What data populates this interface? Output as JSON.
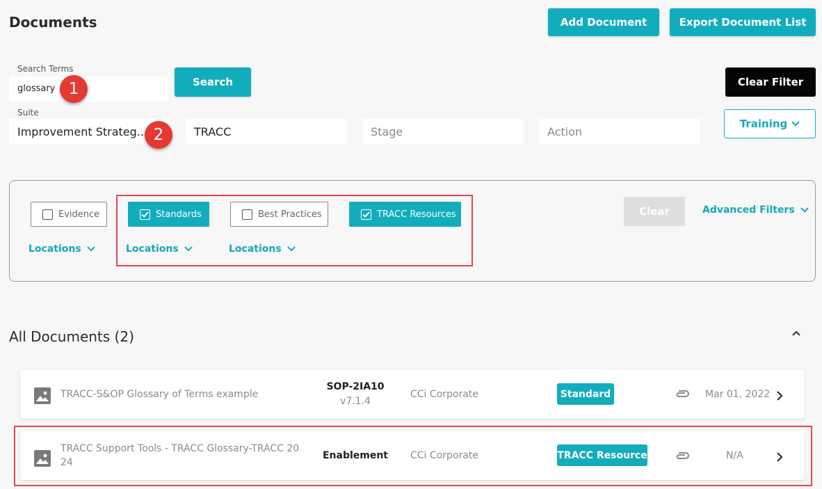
{
  "header": {
    "title": "Documents",
    "add_document": "Add Document",
    "export_list": "Export Document List"
  },
  "search": {
    "label": "Search Terms",
    "value": "glossary",
    "button": "Search",
    "clear_filter": "Clear Filter"
  },
  "suite": {
    "label": "Suite",
    "value": "Improvement Strateg...",
    "secondary_value": "TRACC",
    "stage_placeholder": "Stage",
    "action_placeholder": "Action",
    "training_label": "Training"
  },
  "annotations": {
    "marker_1": "1",
    "marker_2": "2"
  },
  "filters": {
    "types": [
      {
        "label": "Evidence",
        "checked": false
      },
      {
        "label": "Standards",
        "checked": true
      },
      {
        "label": "Best Practices",
        "checked": false
      },
      {
        "label": "TRACC Resources",
        "checked": true
      }
    ],
    "locations": [
      "Locations",
      "Locations",
      "Locations"
    ],
    "clear": "Clear",
    "advanced": "Advanced Filters"
  },
  "documents": {
    "title": "All Documents (2)",
    "items": [
      {
        "name": "TRACC-S&OP Glossary of Terms example",
        "code": "SOP-2IA10",
        "version": "v7.1.4",
        "org": "CCi Corporate",
        "type": "Standard",
        "date": "Mar 01, 2022"
      },
      {
        "name_line1": "TRACC Support Tools - TRACC Glossary-TRACC 20",
        "name_line2": "24",
        "code": "Enablement",
        "org": "CCi Corporate",
        "type": "TRACC Resource",
        "date": "N/A"
      }
    ]
  },
  "colors": {
    "accent": "#12adbd",
    "annotation_red": "#e53935",
    "frame_red": "#e0474c"
  }
}
